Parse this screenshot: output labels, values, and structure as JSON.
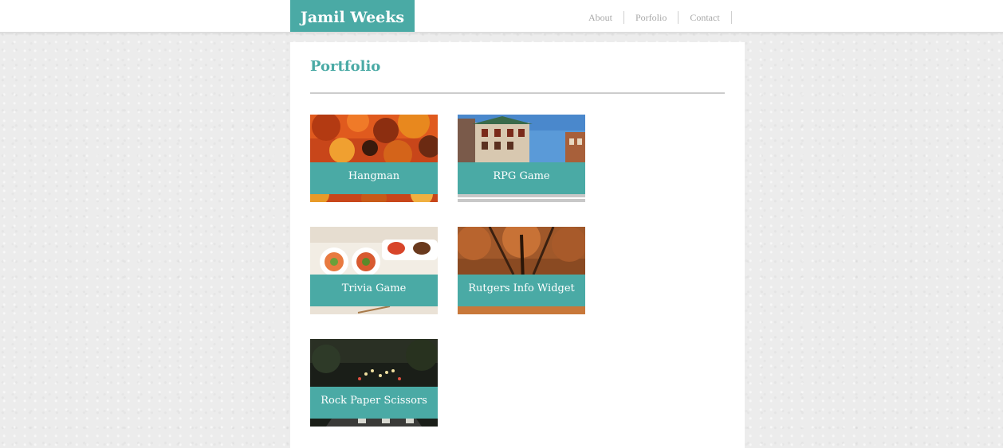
{
  "header": {
    "brand": "Jamil Weeks",
    "nav": [
      "About",
      "Porfolio",
      "Contact"
    ]
  },
  "main": {
    "title": "Portfolio",
    "projects": [
      {
        "label": "Hangman",
        "image": "autumn-leaves-image"
      },
      {
        "label": "RPG Game",
        "image": "chinatown-building-image"
      },
      {
        "label": "Trivia Game",
        "image": "sushi-plate-image"
      },
      {
        "label": "Rutgers Info Widget",
        "image": "autumn-trees-image"
      },
      {
        "label": "Rock Paper Scissors",
        "image": "night-traffic-image"
      }
    ]
  },
  "colors": {
    "accent": "#4aaaa5",
    "nav_text": "#a8a8a8",
    "page_background": "#ececec"
  }
}
